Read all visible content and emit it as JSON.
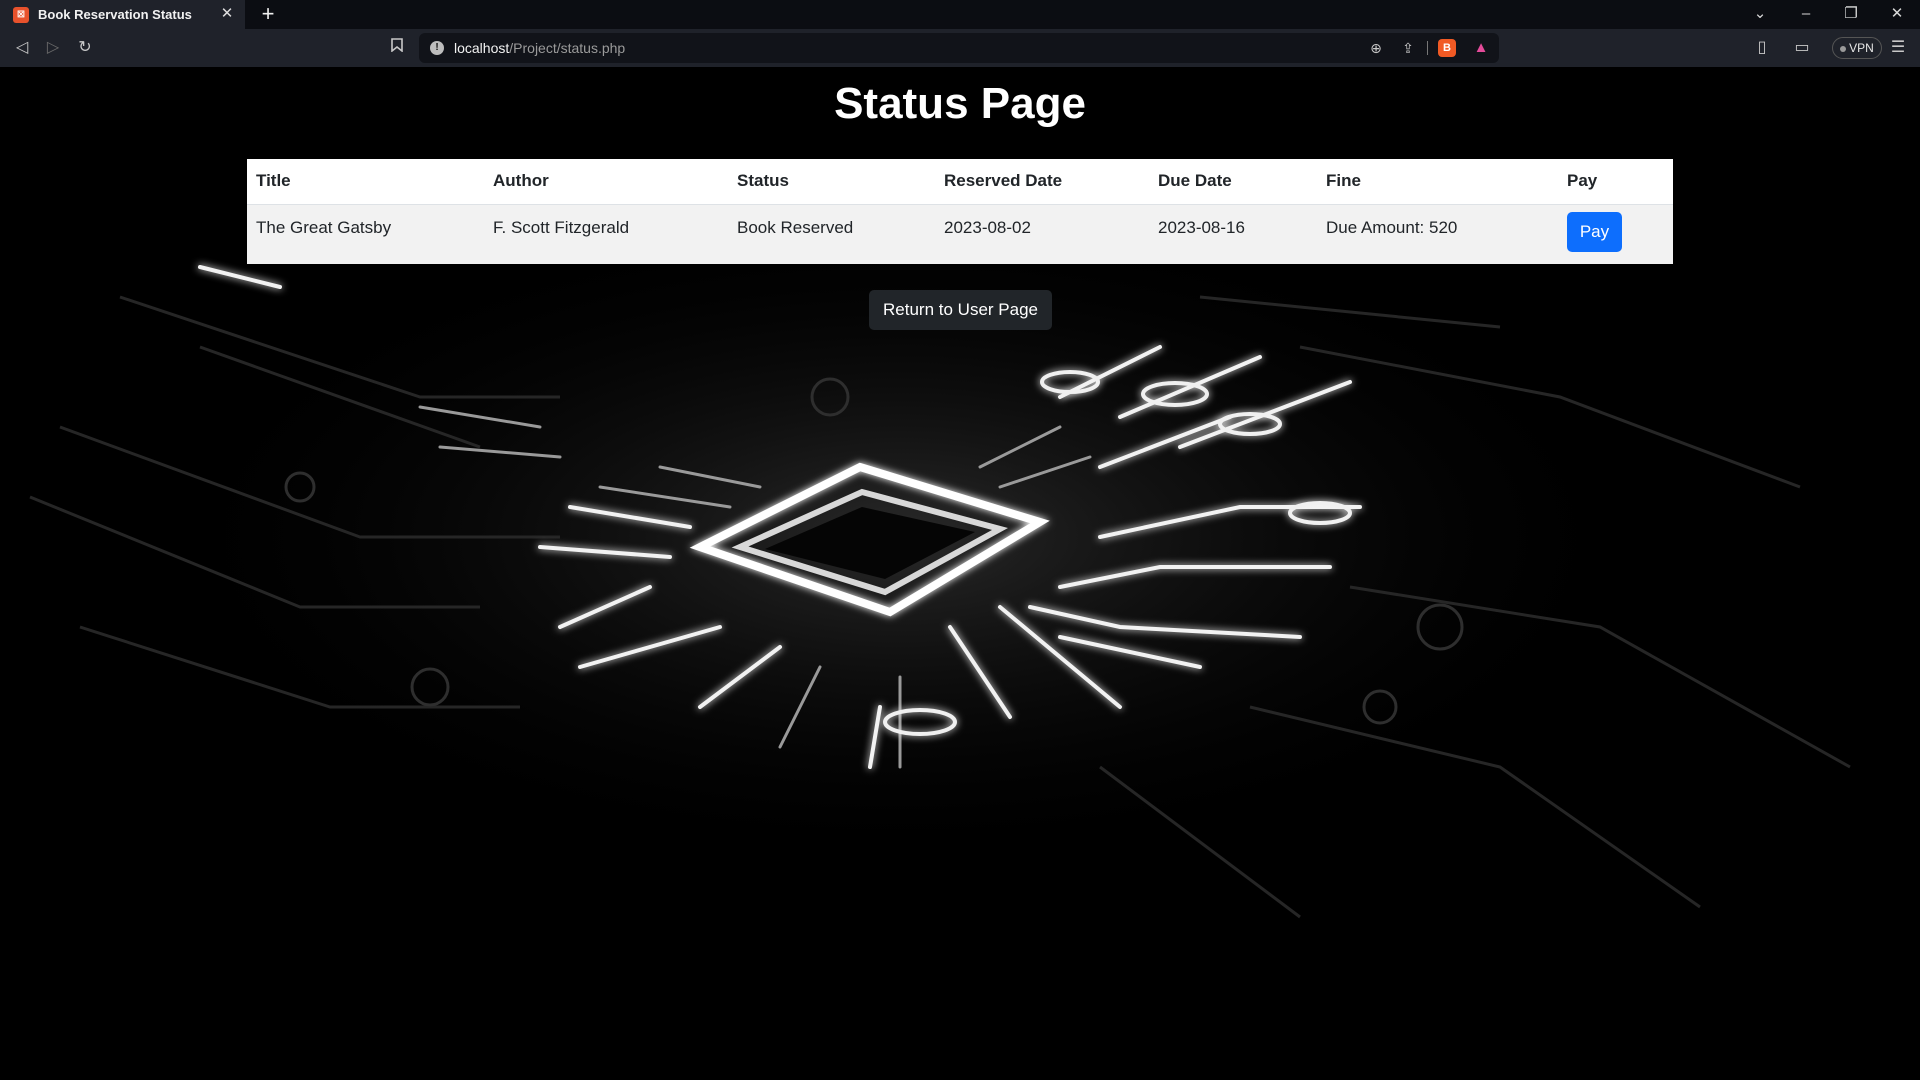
{
  "browser": {
    "tab": {
      "favicon": "xampp-icon",
      "title": "Book Reservation Status"
    },
    "new_tab": "+",
    "window": {
      "tabs_menu": "⌄",
      "minimize": "–",
      "restore": "❐",
      "close": "✕"
    },
    "nav": {
      "back": "◁",
      "forward": "▷",
      "reload": "↻",
      "bookmark": "🔖"
    },
    "url": {
      "host": "localhost",
      "path": "/Project/status.php"
    },
    "url_icons": {
      "zoom": "⊕",
      "share": "⇪",
      "brave": "B",
      "rewards": "▲"
    },
    "right": {
      "sidebar": "▯",
      "wallet": "▭",
      "vpn": "VPN",
      "menu": "☰"
    }
  },
  "page": {
    "title": "Status Page",
    "table": {
      "headers": [
        "Title",
        "Author",
        "Status",
        "Reserved Date",
        "Due Date",
        "Fine",
        "Pay"
      ],
      "rows": [
        {
          "title": "The Great Gatsby",
          "author": "F. Scott Fitzgerald",
          "status": "Book Reserved",
          "reserved_date": "2023-08-02",
          "due_date": "2023-08-16",
          "fine": "Due Amount: 520",
          "pay_label": "Pay"
        }
      ]
    },
    "return_label": "Return to User Page"
  },
  "colors": {
    "background": "#000000",
    "pay_button": "#0d6efd",
    "return_button": "#212529",
    "chrome": "#1f222a"
  }
}
